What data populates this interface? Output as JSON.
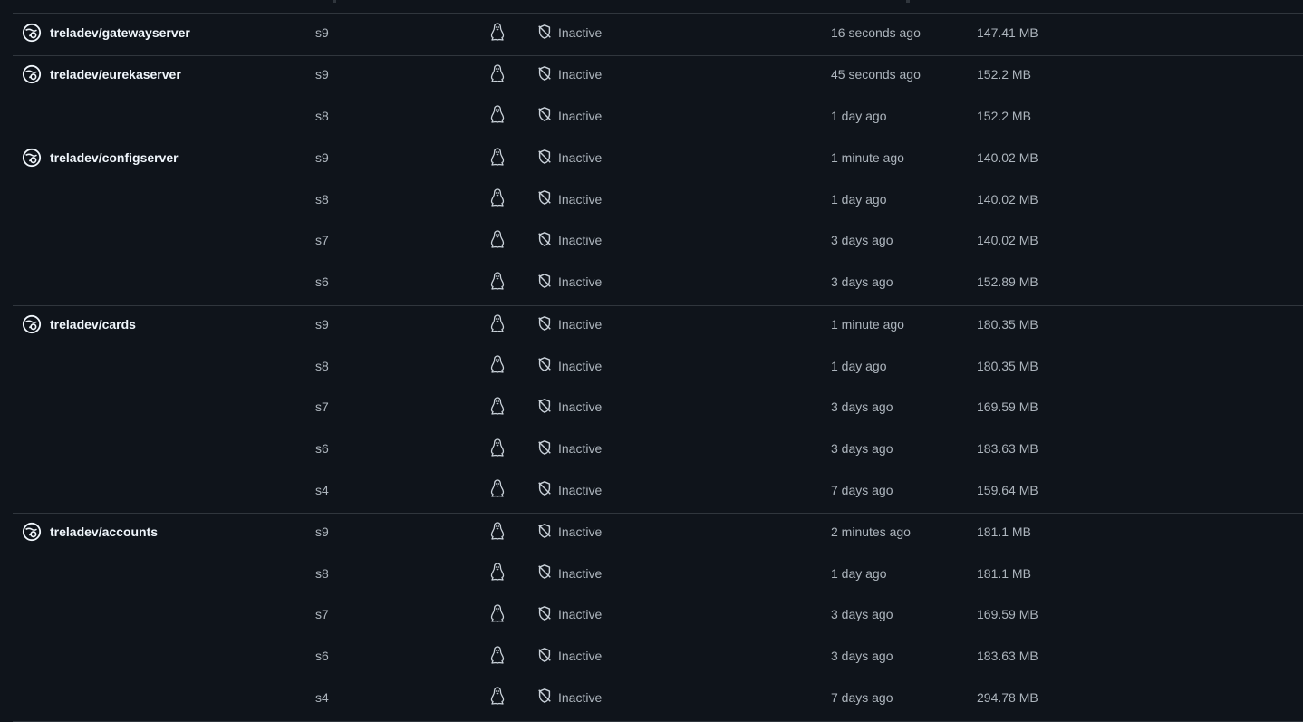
{
  "groups": [
    {
      "repo": "treladev/gatewayserver",
      "versions": [
        {
          "tag": "s9",
          "status": "Inactive",
          "published": "16 seconds ago",
          "size": "147.41 MB"
        }
      ]
    },
    {
      "repo": "treladev/eurekaserver",
      "versions": [
        {
          "tag": "s9",
          "status": "Inactive",
          "published": "45 seconds ago",
          "size": "152.2 MB"
        },
        {
          "tag": "s8",
          "status": "Inactive",
          "published": "1 day ago",
          "size": "152.2 MB"
        }
      ]
    },
    {
      "repo": "treladev/configserver",
      "versions": [
        {
          "tag": "s9",
          "status": "Inactive",
          "published": "1 minute ago",
          "size": "140.02 MB"
        },
        {
          "tag": "s8",
          "status": "Inactive",
          "published": "1 day ago",
          "size": "140.02 MB"
        },
        {
          "tag": "s7",
          "status": "Inactive",
          "published": "3 days ago",
          "size": "140.02 MB"
        },
        {
          "tag": "s6",
          "status": "Inactive",
          "published": "3 days ago",
          "size": "152.89 MB"
        }
      ]
    },
    {
      "repo": "treladev/cards",
      "versions": [
        {
          "tag": "s9",
          "status": "Inactive",
          "published": "1 minute ago",
          "size": "180.35 MB"
        },
        {
          "tag": "s8",
          "status": "Inactive",
          "published": "1 day ago",
          "size": "180.35 MB"
        },
        {
          "tag": "s7",
          "status": "Inactive",
          "published": "3 days ago",
          "size": "169.59 MB"
        },
        {
          "tag": "s6",
          "status": "Inactive",
          "published": "3 days ago",
          "size": "183.63 MB"
        },
        {
          "tag": "s4",
          "status": "Inactive",
          "published": "7 days ago",
          "size": "159.64 MB"
        }
      ]
    },
    {
      "repo": "treladev/accounts",
      "versions": [
        {
          "tag": "s9",
          "status": "Inactive",
          "published": "2 minutes ago",
          "size": "181.1 MB"
        },
        {
          "tag": "s8",
          "status": "Inactive",
          "published": "1 day ago",
          "size": "181.1 MB"
        },
        {
          "tag": "s7",
          "status": "Inactive",
          "published": "3 days ago",
          "size": "169.59 MB"
        },
        {
          "tag": "s6",
          "status": "Inactive",
          "published": "3 days ago",
          "size": "183.63 MB"
        },
        {
          "tag": "s4",
          "status": "Inactive",
          "published": "7 days ago",
          "size": "294.78 MB"
        }
      ]
    }
  ],
  "icons": {
    "repo": "docker-repo-icon",
    "os": "linux-penguin-icon",
    "status": "shield-slash-icon"
  },
  "colors": {
    "background": "#0f141b",
    "border": "#30363d",
    "repo_text": "#f0f6fc",
    "cell_text": "#adb5bd"
  }
}
